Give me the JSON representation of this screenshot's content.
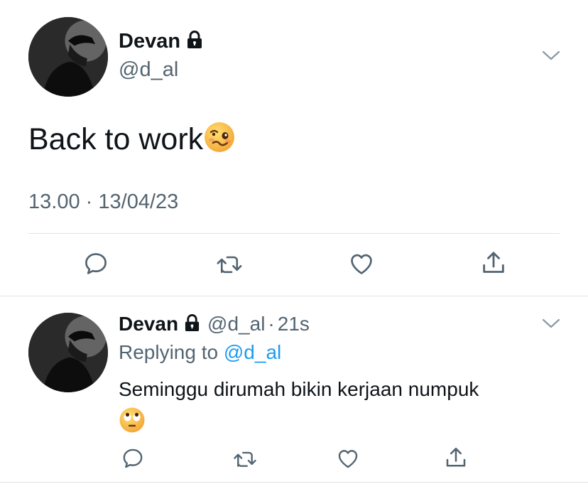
{
  "main_tweet": {
    "author_name": "Devan",
    "author_handle": "@d_al",
    "text": "Back to work",
    "emoji": "woozy-face",
    "time": "13.00",
    "separator": "·",
    "date": "13/04/23"
  },
  "reply_tweet": {
    "author_name": "Devan",
    "author_handle": "@d_al",
    "separator": "·",
    "age": "21s",
    "replying_prefix": "Replying to",
    "replying_to": "@d_al",
    "text": "Seminggu dirumah bikin kerjaan numpuk",
    "emoji": "face-with-rolling-eyes"
  },
  "icons": {
    "reply": "comment-icon",
    "retweet": "retweet-icon",
    "like": "heart-icon",
    "share": "share-icon",
    "menu": "chevron-down-icon",
    "protected": "lock-icon"
  },
  "colors": {
    "text": "#0f1419",
    "secondary": "#536471",
    "link": "#1d9bf0",
    "divider": "#dfe3e6"
  }
}
